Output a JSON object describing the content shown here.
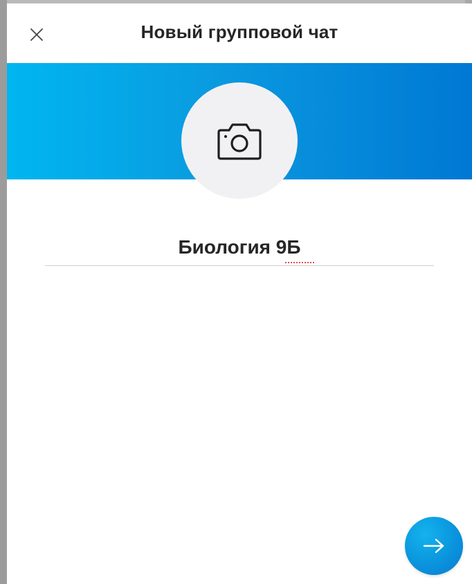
{
  "dialog": {
    "title": "Новый групповой чат",
    "close_icon": "close-icon",
    "banner_gradient": [
      "#00b6f0",
      "#0078d4"
    ],
    "avatar": {
      "icon": "camera-icon",
      "background": "#f1f1f3"
    },
    "group_name": {
      "value": "Биология 9Б"
    },
    "next_button": {
      "icon": "arrow-right-icon",
      "color": "#0a94dd"
    }
  }
}
